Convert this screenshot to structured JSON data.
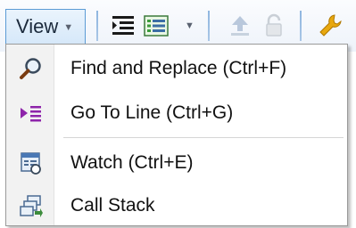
{
  "toolbar": {
    "view_label": "View",
    "icons": [
      "indent-icon",
      "list-view-icon",
      "upload-icon",
      "lock-icon",
      "wrench-icon"
    ]
  },
  "menu": {
    "items": [
      {
        "label": "Find and Replace (Ctrl+F)",
        "icon": "magnifier-icon"
      },
      {
        "label": "Go To Line (Ctrl+G)",
        "icon": "goto-line-icon"
      },
      {
        "label": "Watch (Ctrl+E)",
        "icon": "watch-icon"
      },
      {
        "label": "Call Stack",
        "icon": "call-stack-icon"
      }
    ]
  },
  "colors": {
    "accent": "#5b9bd5",
    "goto_arrow": "#8e24aa",
    "wrench": "#e0a010"
  }
}
